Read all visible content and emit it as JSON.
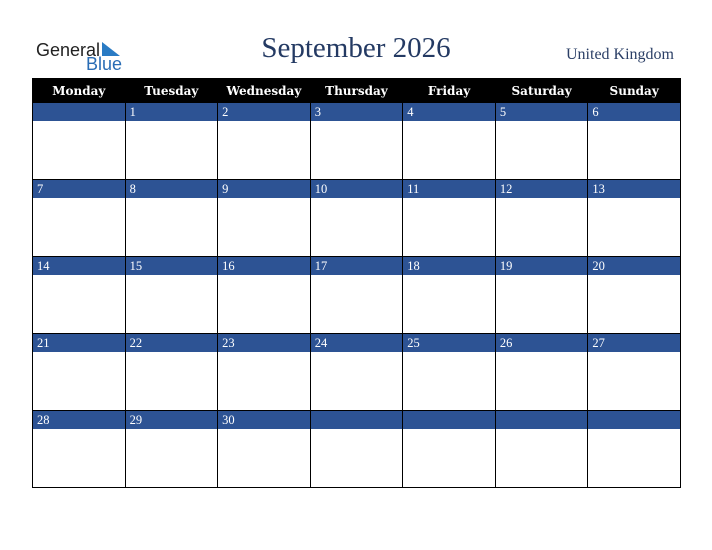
{
  "logo": {
    "line1": "General",
    "line2": "Blue"
  },
  "title": "September 2026",
  "country": "United Kingdom",
  "weekdays": [
    "Monday",
    "Tuesday",
    "Wednesday",
    "Thursday",
    "Friday",
    "Saturday",
    "Sunday"
  ],
  "weeks": [
    [
      "",
      "1",
      "2",
      "3",
      "4",
      "5",
      "6"
    ],
    [
      "7",
      "8",
      "9",
      "10",
      "11",
      "12",
      "13"
    ],
    [
      "14",
      "15",
      "16",
      "17",
      "18",
      "19",
      "20"
    ],
    [
      "21",
      "22",
      "23",
      "24",
      "25",
      "26",
      "27"
    ],
    [
      "28",
      "29",
      "30",
      "",
      "",
      "",
      ""
    ]
  ],
  "colors": {
    "header_bg": "#000000",
    "day_band": "#2d5394",
    "title": "#243a63"
  }
}
